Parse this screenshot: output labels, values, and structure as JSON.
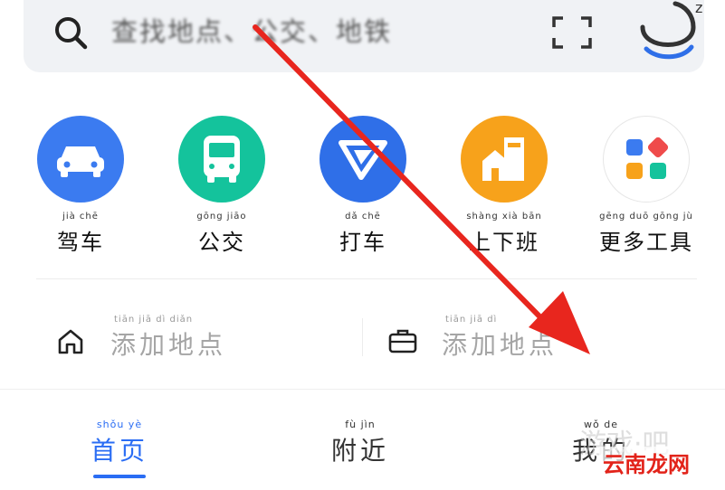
{
  "search": {
    "placeholder": "查找地点、公交、地铁",
    "voice_badge": "z"
  },
  "actions": [
    {
      "pinyin": "jià   chē",
      "label": "驾车",
      "color": "#3b7bf0"
    },
    {
      "pinyin": "gōng  jiāo",
      "label": "公交",
      "color": "#14c39c"
    },
    {
      "pinyin": "dǎ    chē",
      "label": "打车",
      "color": "#2f6fe8"
    },
    {
      "pinyin": "shàng  xià  bān",
      "label": "上下班",
      "color": "#f7a21b"
    },
    {
      "pinyin": "gēng  duō  gōng  jù",
      "label": "更多工具",
      "color": "#ffffff"
    }
  ],
  "places": [
    {
      "pinyin": "tiān    jiā     dì     diǎn",
      "label": "添加地点"
    },
    {
      "pinyin": "tiān    jiā     dì",
      "label": "添加地点"
    }
  ],
  "tabs": [
    {
      "pinyin": "shǒu    yè",
      "label": "首页",
      "active": true
    },
    {
      "pinyin": "fù     jìn",
      "label": "附近",
      "active": false
    },
    {
      "pinyin": "wǒ    de",
      "label": "我的",
      "active": false
    }
  ],
  "watermark": {
    "text": "云南龙网",
    "gray_text": "游戏·吧"
  },
  "colors": {
    "accent": "#2a6df4",
    "arrow": "#e8261e"
  }
}
